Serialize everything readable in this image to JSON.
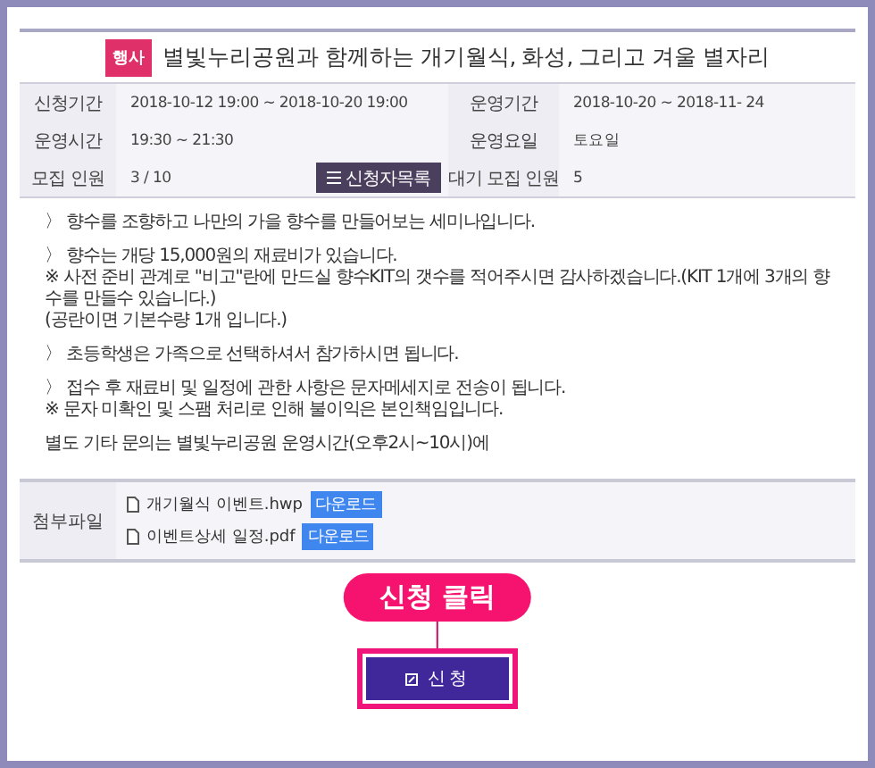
{
  "category_badge": "행사",
  "title": "별빛누리공원과 함께하는 개기월식, 화성, 그리고 겨울 별자리",
  "info_rows": [
    [
      {
        "label": "신청기간",
        "value": "2018-10-12 19:00 ~ 2018-10-20 19:00"
      },
      {
        "label": "운영기간",
        "value": "2018-10-20 ~ 2018-11- 24"
      }
    ],
    [
      {
        "label": "운영시간",
        "value": "19:30 ~ 21:30"
      },
      {
        "label": "운영요일",
        "value": "토요일"
      }
    ],
    [
      {
        "label": "모집 인원",
        "value": "3 / 10",
        "button": "신청자목록"
      },
      {
        "label": "대기 모집 인원",
        "value": "5"
      }
    ]
  ],
  "description": [
    [
      "〉 향수를 조향하고 나만의 가을 향수를 만들어보는 세미나입니다."
    ],
    [
      "〉 향수는 개당 15,000원의 재료비가 있습니다.",
      "※ 사전 준비 관계로 \"비고\"란에 만드실 향수KIT의 갯수를 적어주시면 감사하겠습니다.(KIT 1개에 3개의 향수를 만들수 있습니다.)",
      "(공란이면 기본수량 1개 입니다.)"
    ],
    [
      "〉 초등학생은 가족으로 선택하셔서 참가하시면 됩니다."
    ],
    [
      "〉 접수 후 재료비 및 일정에 관한 사항은 문자메세지로 전송이 됩니다.",
      "※ 문자 미확인 및 스팸 처리로 인해 불이익은 본인책임입니다."
    ],
    [
      "별도 기타 문의는 별빛누리공원 운영시간(오후2시~10시)에"
    ]
  ],
  "attachments": {
    "label": "첨부파일",
    "files": [
      {
        "name": "개기월식 이벤트.hwp",
        "button": "다운로드"
      },
      {
        "name": "이벤트상세 일정.pdf",
        "button": "다운로드"
      }
    ]
  },
  "apply_button": "신청",
  "callout": "신청 클릭"
}
